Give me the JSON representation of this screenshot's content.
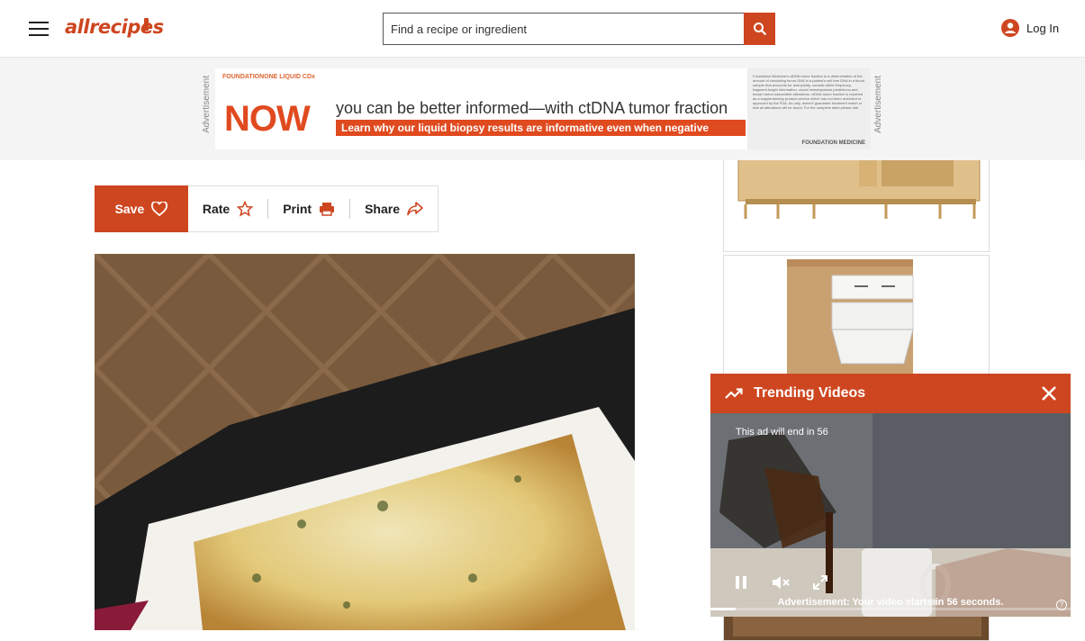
{
  "header": {
    "logo": "allrecipes",
    "search_placeholder": "Find a recipe or ingredient",
    "login_label": "Log In"
  },
  "ad": {
    "label_left": "Advertisement",
    "label_right": "Advertisement",
    "brand": "FOUNDATIONONE LIQUID CDx",
    "headline_big": "NOW",
    "headline_rest": "you can be better informed—with ctDNA tumor fraction",
    "subline": "Learn why our liquid biopsy results are informative even when negative",
    "fine_print": "Foundation Medicine's ctDNA tumor fraction is a determination of the amount of circulating tumor DNA in a patient's cell free DNA in a blood sample that accounts for aneuploidy, somatic allele frequency, fragment length information, clonal hematopoiesis predictions and known tumor-associated alterations. ctDNA tumor fraction is reported as a supplementary product service which has not been reviewed or approved by the FDA. As only, doesn't guarantee treatment match or that all alterations will be found. For the complete label please visit",
    "fine_brand": "FOUNDATION MEDICINE",
    "colors": {
      "accent": "#e04a1f"
    }
  },
  "actions": {
    "save_label": "Save",
    "rate_label": "Rate",
    "print_label": "Print",
    "share_label": "Share"
  },
  "player": {
    "title": "Trending Videos",
    "ad_countdown": "This ad will end in 56",
    "footer": "Advertisement: Your video starts in 56 seconds.",
    "progress": 0.07
  },
  "colors": {
    "brand": "#ce4620"
  }
}
